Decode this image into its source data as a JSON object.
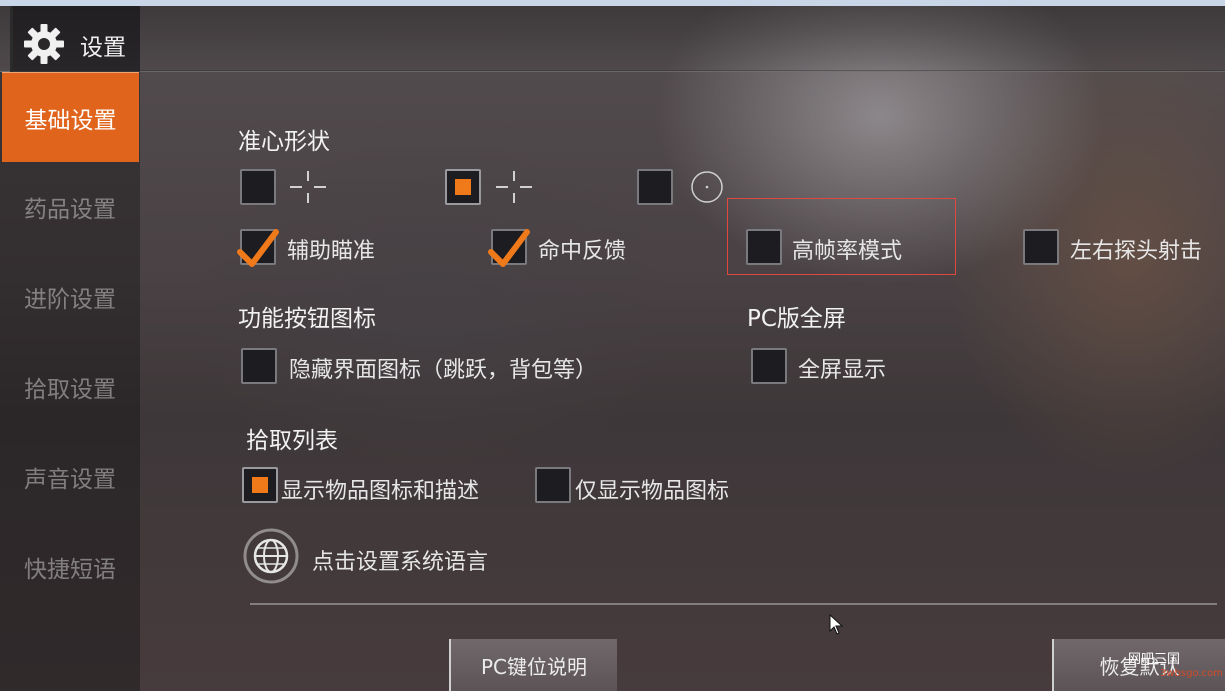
{
  "window": {
    "title": "设置"
  },
  "sidebar": {
    "items": [
      {
        "label": "基础设置",
        "active": true
      },
      {
        "label": "药品设置",
        "active": false
      },
      {
        "label": "进阶设置",
        "active": false
      },
      {
        "label": "拾取设置",
        "active": false
      },
      {
        "label": "声音设置",
        "active": false
      },
      {
        "label": "快捷短语",
        "active": false
      }
    ]
  },
  "crosshair": {
    "title": "准心形状",
    "options": [
      {
        "icon": "crosshair-gap-icon",
        "checked": false
      },
      {
        "icon": "crosshair-gap-icon",
        "checked": true
      },
      {
        "icon": "crosshair-dot-circle-icon",
        "checked": false
      }
    ]
  },
  "toggles": {
    "aim_assist": {
      "label": "辅助瞄准",
      "checked": true
    },
    "hit_feedback": {
      "label": "命中反馈",
      "checked": true
    },
    "high_fps": {
      "label": "高帧率模式",
      "checked": false
    },
    "peek_fire": {
      "label": "左右探头射击",
      "checked": false
    }
  },
  "func_icons": {
    "title": "功能按钮图标",
    "hide_ui": {
      "label": "隐藏界面图标（跳跃，背包等）",
      "checked": false
    }
  },
  "pc_fullscreen": {
    "title": "PC版全屏",
    "fullscreen": {
      "label": "全屏显示",
      "checked": false
    }
  },
  "pickup_list": {
    "title": "拾取列表",
    "show_icon_desc": {
      "label": "显示物品图标和描述",
      "checked": true
    },
    "show_icon_only": {
      "label": "仅显示物品图标",
      "checked": false
    }
  },
  "language": {
    "label": "点击设置系统语言"
  },
  "footer": {
    "pc_keys_label": "PC键位说明",
    "restore_label": "恢复默认"
  },
  "watermark": {
    "text": "网吧三国",
    "sub": "3wbsgo.com"
  },
  "colors": {
    "accent": "#e0641c",
    "check": "#f07a1a",
    "highlight": "#e0483e"
  }
}
